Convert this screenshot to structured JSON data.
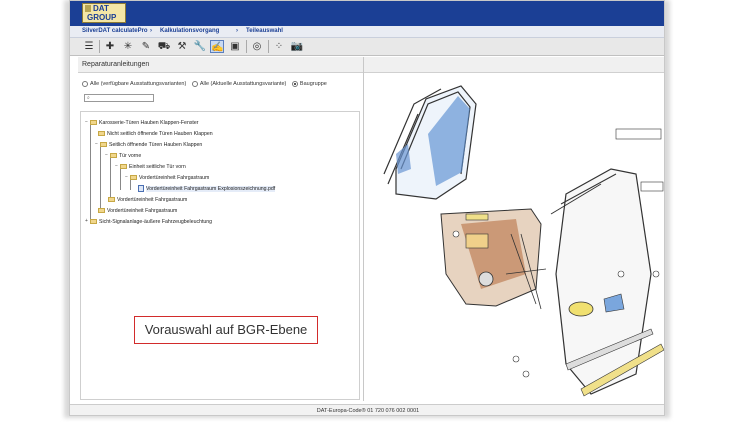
{
  "app": {
    "logo_line1": "DAT",
    "logo_line2": "GROUP",
    "brand_color": "#1b3f95"
  },
  "breadcrumb": {
    "items": [
      "SilverDAT calculatePro",
      "Kalkulationsvorgang",
      "Teileauswahl"
    ],
    "separator": "›"
  },
  "toolbar": {
    "icons": [
      "menu-icon",
      "add-parts-icon",
      "sparkle-icon",
      "paint-icon",
      "car-icon",
      "car-damage-icon",
      "wrench-icon",
      "repair-instructions-icon",
      "image-icon",
      "tire-icon",
      "grid-icon",
      "camera-icon"
    ],
    "active_icon": "repair-instructions-icon"
  },
  "panel": {
    "title": "Reparaturanleitungen"
  },
  "filters": {
    "options": [
      {
        "label": "Alle (verfügbare Ausstattungsvarianten)",
        "selected": false
      },
      {
        "label": "Alle (Aktuelle Ausstattungsvariante)",
        "selected": false
      },
      {
        "label": "Baugruppe",
        "selected": true
      }
    ],
    "search_value": "",
    "search_icon": "search-icon"
  },
  "tree": {
    "nodes": [
      {
        "label": "Karosserie-Türen Hauben Klappen-Fenster",
        "level": 0,
        "type": "folder"
      },
      {
        "label": "Nicht seitlich öffnende Türen Hauben Klappen",
        "level": 1,
        "type": "folder"
      },
      {
        "label": "Seitlich öffnende Türen Hauben Klappen",
        "level": 1,
        "type": "folder"
      },
      {
        "label": "Tür vorne",
        "level": 2,
        "type": "folder"
      },
      {
        "label": "Einheit seitliche Tür vorn",
        "level": 3,
        "type": "folder"
      },
      {
        "label": "Vordertüreinheit Fahrgastraum",
        "level": 4,
        "type": "folder"
      },
      {
        "label": "Vordertüreinheit Fahrgastraum Explosionszeichnung.pdf",
        "level": 5,
        "type": "pdf"
      },
      {
        "label": "Vordertüreinheit Fahrgastraum",
        "level": 2,
        "type": "folder"
      },
      {
        "label": "Vordertüreinheit Fahrgastraum",
        "level": 1,
        "type": "folder"
      },
      {
        "label": "Sicht-Signalanlage-äußere Fahrzeugbeleuchtung",
        "level": 0,
        "type": "folder"
      }
    ]
  },
  "callout": {
    "text": "Vorauswahl auf BGR-Ebene",
    "border_color": "#d22b2b"
  },
  "footer": {
    "text": "DAT-Europa-Code® 01 720 076 002 0001"
  }
}
